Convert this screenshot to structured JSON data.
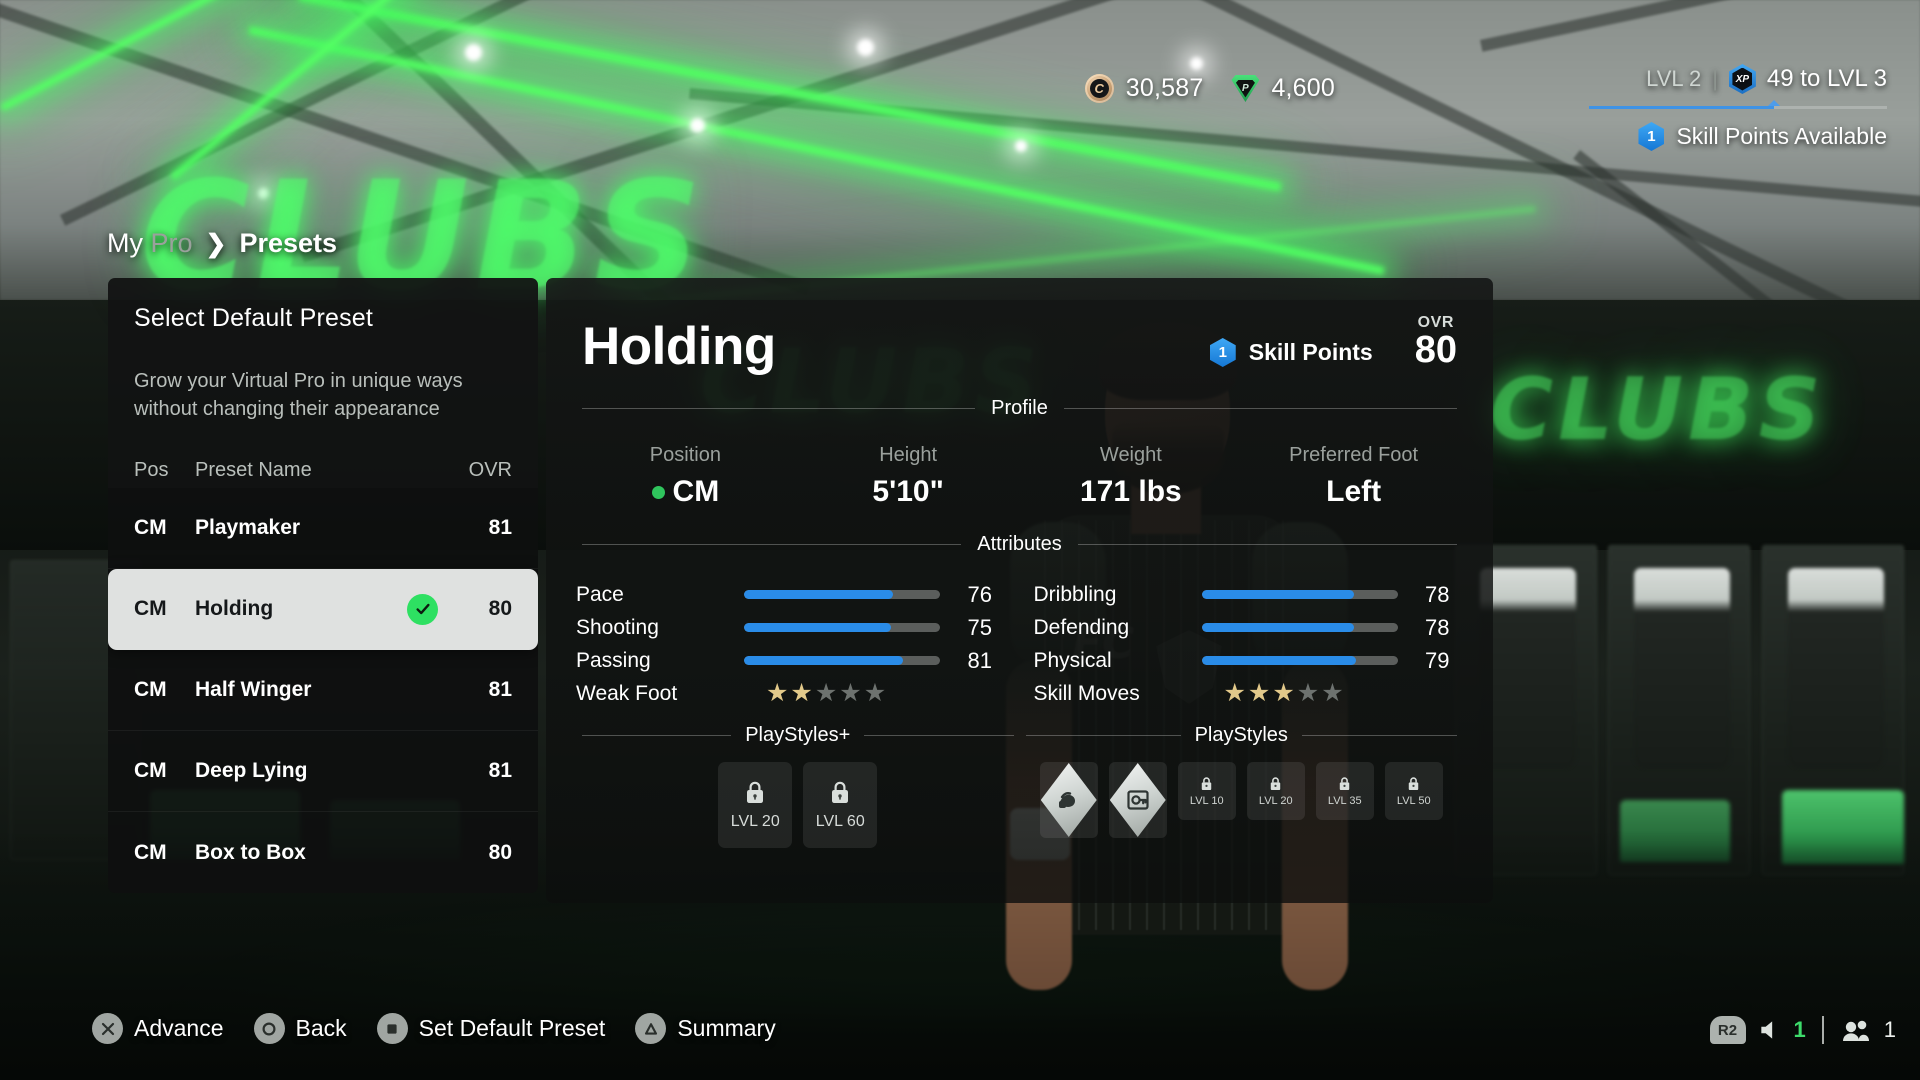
{
  "hud": {
    "coin_icon": "coin-icon",
    "coins": "30,587",
    "gem_icon": "points-gem-icon",
    "points": "4,600",
    "level_label": "LVL 2",
    "separator": "|",
    "xp_icon": "xp-badge-icon",
    "xp_to_next": "49 to LVL 3",
    "xp_progress_percent": 62,
    "skill_points_count": "1",
    "skill_points_label": "Skill Points Available"
  },
  "breadcrumb": {
    "root": "My Pro",
    "chevron": "chevron-right-icon",
    "current": "Presets"
  },
  "preset_panel": {
    "title": "Select Default Preset",
    "subtitle": "Grow your Virtual Pro in unique ways without changing their appearance",
    "columns": {
      "pos": "Pos",
      "name": "Preset Name",
      "ovr": "OVR"
    },
    "rows": [
      {
        "pos": "CM",
        "name": "Playmaker",
        "ovr": "81",
        "selected": false,
        "default": false
      },
      {
        "pos": "CM",
        "name": "Holding",
        "ovr": "80",
        "selected": true,
        "default": true
      },
      {
        "pos": "CM",
        "name": "Half Winger",
        "ovr": "81",
        "selected": false,
        "default": false
      },
      {
        "pos": "CM",
        "name": "Deep Lying",
        "ovr": "81",
        "selected": false,
        "default": false
      },
      {
        "pos": "CM",
        "name": "Box to Box",
        "ovr": "80",
        "selected": false,
        "default": false
      }
    ]
  },
  "detail": {
    "title": "Holding",
    "skill_points_count": "1",
    "skill_points_label": "Skill Points",
    "ovr_label": "OVR",
    "ovr_value": "80",
    "profile_heading": "Profile",
    "profile": [
      {
        "label": "Position",
        "value": "CM",
        "dot": true
      },
      {
        "label": "Height",
        "value": "5'10\"",
        "dot": false
      },
      {
        "label": "Weight",
        "value": "171 lbs",
        "dot": false
      },
      {
        "label": "Preferred Foot",
        "value": "Left",
        "dot": false
      }
    ],
    "attributes_heading": "Attributes",
    "attributes_left": [
      {
        "name": "Pace",
        "value": "76",
        "pct": 76
      },
      {
        "name": "Shooting",
        "value": "75",
        "pct": 75
      },
      {
        "name": "Passing",
        "value": "81",
        "pct": 81
      }
    ],
    "attributes_right": [
      {
        "name": "Dribbling",
        "value": "78",
        "pct": 78
      },
      {
        "name": "Defending",
        "value": "78",
        "pct": 78
      },
      {
        "name": "Physical",
        "value": "79",
        "pct": 79
      }
    ],
    "weak_foot": {
      "label": "Weak Foot",
      "stars": 2,
      "max": 5
    },
    "skill_moves": {
      "label": "Skill Moves",
      "stars": 3,
      "max": 5
    },
    "playstyles_plus": {
      "heading": "PlayStyles+",
      "slots": [
        {
          "icon": "lock-icon",
          "level": "LVL 20",
          "locked": true
        },
        {
          "icon": "lock-icon",
          "level": "LVL 60",
          "locked": true
        }
      ]
    },
    "playstyles": {
      "heading": "PlayStyles",
      "slots": [
        {
          "icon": "strength-flex-icon",
          "level": "",
          "locked": false
        },
        {
          "icon": "block-shield-icon",
          "level": "",
          "locked": false
        },
        {
          "icon": "lock-icon",
          "level": "LVL 10",
          "locked": true
        },
        {
          "icon": "lock-icon",
          "level": "LVL 20",
          "locked": true
        },
        {
          "icon": "lock-icon",
          "level": "LVL 35",
          "locked": true
        },
        {
          "icon": "lock-icon",
          "level": "LVL 50",
          "locked": true
        }
      ]
    }
  },
  "bottom_bar": {
    "actions": [
      {
        "button": "✕",
        "icon": "cross-button-icon",
        "label": "Advance"
      },
      {
        "button": "",
        "icon": "circle-button-icon",
        "label": "Back"
      },
      {
        "button": "",
        "icon": "square-button-icon",
        "label": "Set Default Preset"
      },
      {
        "button": "",
        "icon": "triangle-button-icon",
        "label": "Summary"
      }
    ],
    "r2_label": "R2",
    "volume_value": "1",
    "players_value": "1"
  },
  "background": {
    "wall_text": "CLUBS",
    "accent_green": "#3ddb6b",
    "accent_blue": "#2a8ce8"
  }
}
